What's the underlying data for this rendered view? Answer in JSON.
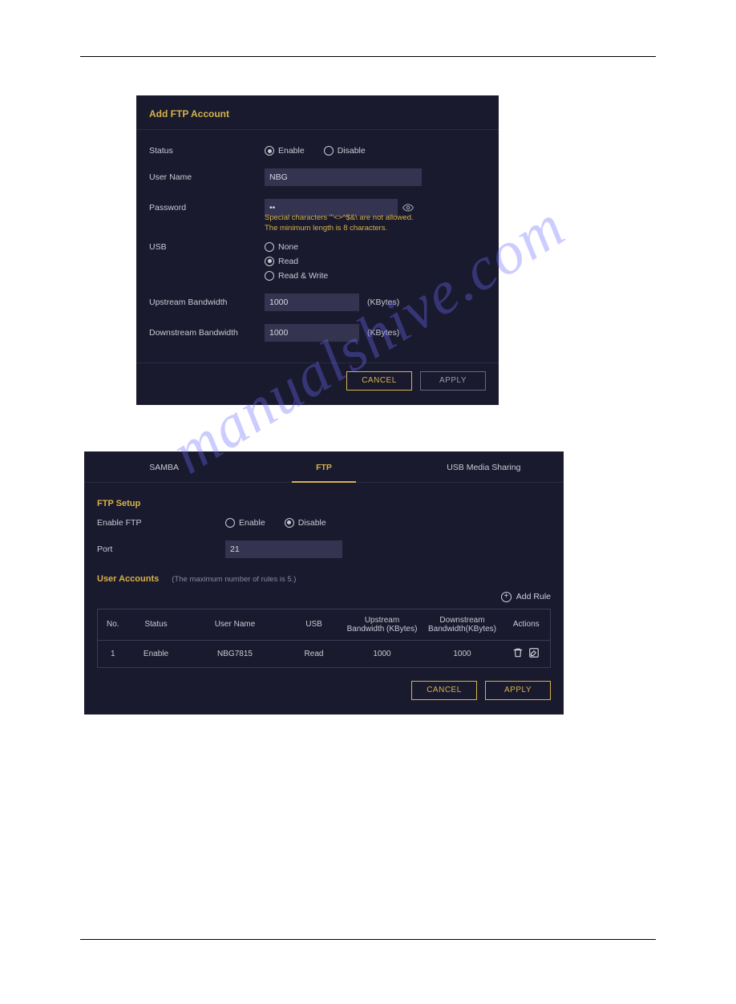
{
  "watermark": "manualshive.com",
  "panel1": {
    "title": "Add FTP Account",
    "status_label": "Status",
    "status_options": {
      "enable": "Enable",
      "disable": "Disable"
    },
    "status_selected": "enable",
    "username_label": "User Name",
    "username_value": "NBG",
    "password_label": "Password",
    "password_value": "••",
    "password_hint_line1": "Special characters '\"<>^$&\\ are not allowed.",
    "password_hint_line2": "The minimum length is 8 characters.",
    "usb_label": "USB",
    "usb_options": {
      "none": "None",
      "read": "Read",
      "readwrite": "Read & Write"
    },
    "usb_selected": "read",
    "up_label": "Upstream Bandwidth",
    "up_value": "1000",
    "down_label": "Downstream Bandwidth",
    "down_value": "1000",
    "unit": "(KBytes)",
    "cancel": "CANCEL",
    "apply": "APPLY"
  },
  "panel2": {
    "tabs": {
      "samba": "SAMBA",
      "ftp": "FTP",
      "usb": "USB Media Sharing"
    },
    "active_tab": "ftp",
    "setup_title": "FTP Setup",
    "enable_ftp_label": "Enable FTP",
    "enable_ftp_options": {
      "enable": "Enable",
      "disable": "Disable"
    },
    "enable_ftp_selected": "disable",
    "port_label": "Port",
    "port_value": "21",
    "accounts_title": "User Accounts",
    "accounts_note": "(The maximum number of rules is 5.)",
    "add_rule": "Add Rule",
    "columns": {
      "no": "No.",
      "status": "Status",
      "username": "User Name",
      "usb": "USB",
      "up": "Upstream Bandwidth (KBytes)",
      "down": "Downstream Bandwidth(KBytes)",
      "actions": "Actions"
    },
    "rows": [
      {
        "no": "1",
        "status": "Enable",
        "username": "NBG7815",
        "usb": "Read",
        "up": "1000",
        "down": "1000"
      }
    ],
    "cancel": "CANCEL",
    "apply": "APPLY"
  }
}
